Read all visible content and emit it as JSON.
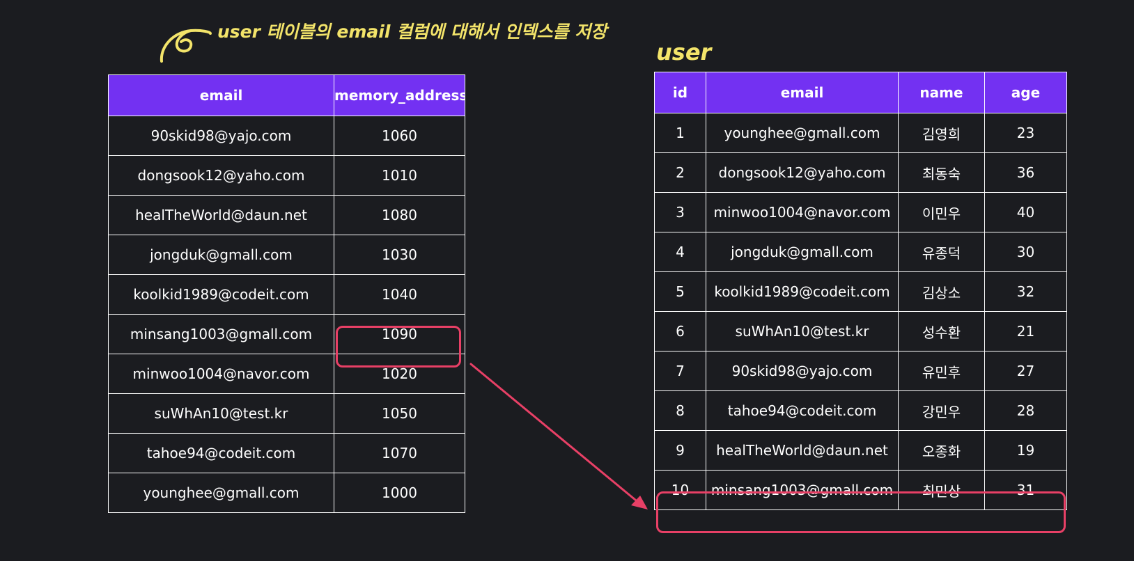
{
  "annotation": {
    "text": "user 테이블의 email 컬럼에 대해서 인덱스를 저장"
  },
  "index_table": {
    "headers": [
      "email",
      "memory_address"
    ],
    "rows": [
      [
        "90skid98@yajo.com",
        "1060"
      ],
      [
        "dongsook12@yaho.com",
        "1010"
      ],
      [
        "healTheWorld@daun.net",
        "1080"
      ],
      [
        "jongduk@gmall.com",
        "1030"
      ],
      [
        "koolkid1989@codeit.com",
        "1040"
      ],
      [
        "minsang1003@gmall.com",
        "1090"
      ],
      [
        "minwoo1004@navor.com",
        "1020"
      ],
      [
        "suWhAn10@test.kr",
        "1050"
      ],
      [
        "tahoe94@codeit.com",
        "1070"
      ],
      [
        "younghee@gmall.com",
        "1000"
      ]
    ]
  },
  "user_table": {
    "caption": "user",
    "headers": [
      "id",
      "email",
      "name",
      "age"
    ],
    "rows": [
      [
        "1",
        "younghee@gmall.com",
        "김영희",
        "23"
      ],
      [
        "2",
        "dongsook12@yaho.com",
        "최동숙",
        "36"
      ],
      [
        "3",
        "minwoo1004@navor.com",
        "이민우",
        "40"
      ],
      [
        "4",
        "jongduk@gmall.com",
        "유종덕",
        "30"
      ],
      [
        "5",
        "koolkid1989@codeit.com",
        "김상소",
        "32"
      ],
      [
        "6",
        "suWhAn10@test.kr",
        "성수환",
        "21"
      ],
      [
        "7",
        "90skid98@yajo.com",
        "유민후",
        "27"
      ],
      [
        "8",
        "tahoe94@codeit.com",
        "강민우",
        "28"
      ],
      [
        "9",
        "healTheWorld@daun.net",
        "오종화",
        "19"
      ],
      [
        "10",
        "minsang1003@gmall.com",
        "최민상",
        "31"
      ]
    ]
  },
  "colors": {
    "background": "#1b1c20",
    "header": "#7331f2",
    "highlight": "#e84066",
    "annotation": "#f3e46a",
    "grid": "#ffffff"
  },
  "icons": {
    "swirl": "swirl-icon",
    "pointer_arrow": "arrow-icon"
  }
}
